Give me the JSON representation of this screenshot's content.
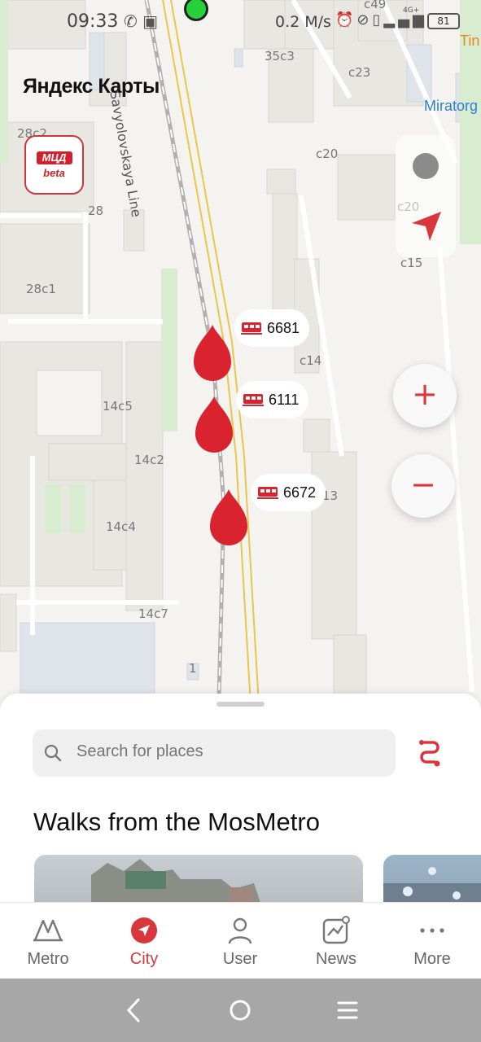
{
  "status_bar": {
    "time": "09:33",
    "speed": "0.2 M/s",
    "signal": "4G+",
    "battery": "81"
  },
  "map": {
    "provider_logo": "Яндекс Карты",
    "mcd_badge": {
      "top": "МЦД",
      "bottom": "beta"
    },
    "road_name": "Savyolovskaya Line",
    "labels": [
      "35c3",
      "c23",
      "c49",
      "28c2",
      "28",
      "28c1",
      "c20",
      "c20",
      "c15",
      "c14",
      "14c5",
      "14c2",
      "14c4",
      "14c7",
      "1",
      "13"
    ],
    "poi": {
      "tin": "Tin",
      "miratorg": "Miratorg"
    },
    "trains": [
      {
        "number": "6681"
      },
      {
        "number": "6111"
      },
      {
        "number": "6672"
      }
    ],
    "zoom_in_icon": "plus-icon",
    "zoom_out_icon": "minus-icon"
  },
  "sheet": {
    "search_placeholder": "Search for places",
    "section_title": "Walks from the MosMetro"
  },
  "tabs": [
    {
      "label": "Metro",
      "icon": "metro-icon",
      "active": false
    },
    {
      "label": "City",
      "icon": "navigation-arrow-icon",
      "active": true
    },
    {
      "label": "User",
      "icon": "user-icon",
      "active": false
    },
    {
      "label": "News",
      "icon": "news-chart-icon",
      "active": false
    },
    {
      "label": "More",
      "icon": "more-dots-icon",
      "active": false
    }
  ],
  "colors": {
    "accent": "#d9363e",
    "pin": "#d9232f"
  }
}
